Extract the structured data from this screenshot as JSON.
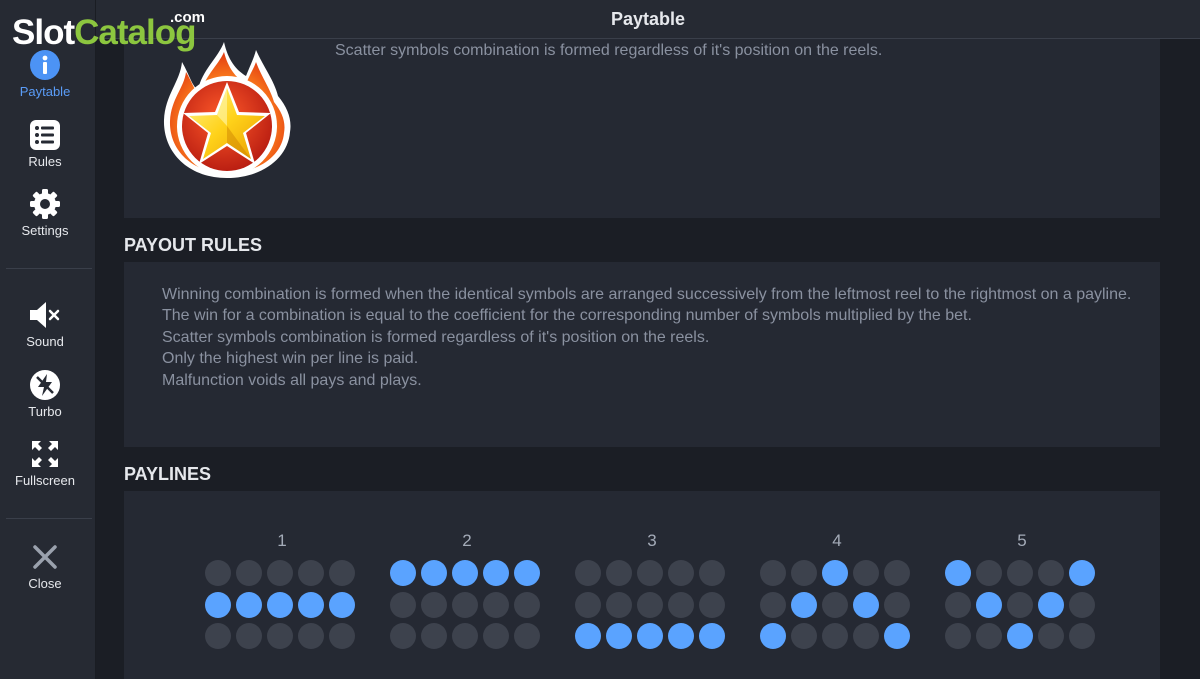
{
  "logo": {
    "part1": "Slot",
    "part2": "Catalog",
    "suffix": ".com"
  },
  "header": {
    "title": "Paytable"
  },
  "sidebar": {
    "items": [
      {
        "label": "Paytable",
        "icon": "info-icon",
        "active": true
      },
      {
        "label": "Rules",
        "icon": "list-icon",
        "active": false
      },
      {
        "label": "Settings",
        "icon": "gear-icon",
        "active": false
      },
      {
        "label": "Sound",
        "icon": "sound-muted-icon",
        "active": false
      },
      {
        "label": "Turbo",
        "icon": "turbo-icon",
        "active": false
      },
      {
        "label": "Fullscreen",
        "icon": "fullscreen-icon",
        "active": false
      },
      {
        "label": "Close",
        "icon": "close-icon",
        "active": false
      }
    ]
  },
  "scatter": {
    "description": "Scatter symbols combination is formed regardless of it's position on the reels.",
    "icon": "flaming-star-icon"
  },
  "payout_rules": {
    "title": "PAYOUT RULES",
    "lines": [
      "Winning combination is formed when the identical symbols are arranged successively from the leftmost reel to the rightmost on a payline.",
      "The win for a combination is equal to the coefficient for the corresponding number of symbols multiplied by the bet.",
      "Scatter symbols combination is formed regardless of it's position on the reels.",
      "Only the highest win per line is paid.",
      "Malfunction voids all pays and plays."
    ]
  },
  "paylines": {
    "title": "PAYLINES",
    "lines": [
      {
        "number": "1",
        "rows": [
          1,
          1,
          1,
          1,
          1
        ]
      },
      {
        "number": "2",
        "rows": [
          0,
          0,
          0,
          0,
          0
        ]
      },
      {
        "number": "3",
        "rows": [
          2,
          2,
          2,
          2,
          2
        ]
      },
      {
        "number": "4",
        "rows": [
          2,
          1,
          0,
          1,
          2
        ]
      },
      {
        "number": "5",
        "rows": [
          0,
          1,
          2,
          1,
          0
        ]
      }
    ]
  },
  "colors": {
    "accent": "#5aa3ff",
    "active_label": "#5a9cf7",
    "inactive_dot": "#3d424d",
    "background": "#1b1e25",
    "panel": "#252933",
    "logo_green": "#8cc63f"
  }
}
